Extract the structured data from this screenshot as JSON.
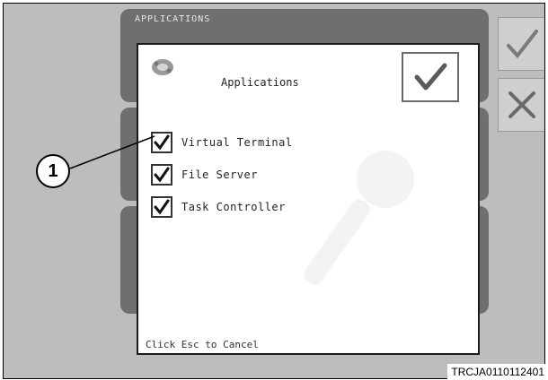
{
  "screen": {
    "panel_title": "APPLICATIONS",
    "side_buttons": [
      {
        "icon": "checkmark-icon"
      },
      {
        "icon": "x-icon"
      }
    ]
  },
  "dialog": {
    "icon": "applications-icon",
    "title": "Applications",
    "ok_icon": "checkmark-icon",
    "options": [
      {
        "label": "Virtual Terminal",
        "checked": true
      },
      {
        "label": "File Server",
        "checked": true
      },
      {
        "label": "Task Controller",
        "checked": true
      }
    ],
    "footer": "Click Esc to Cancel"
  },
  "annotation": {
    "callout_number": "1",
    "figure_code": "TRCJA0110112401"
  }
}
